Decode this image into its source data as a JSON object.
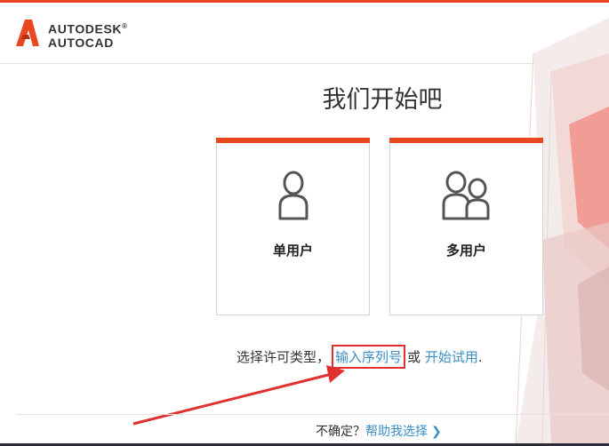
{
  "brand": {
    "line1": "AUTODESK",
    "trademark": "®",
    "line2": "AUTOCAD",
    "accent_color": "#e8471f"
  },
  "page": {
    "title": "我们开始吧"
  },
  "cards": {
    "single": {
      "label": "单用户",
      "icon": "single-user-icon"
    },
    "multi": {
      "label": "多用户",
      "icon": "multi-user-icon"
    }
  },
  "license": {
    "prompt": "选择许可类型，",
    "serial_link": "输入序列号",
    "or": "或",
    "trial_link": "开始试用",
    "end": "."
  },
  "footer": {
    "unsure": "不确定？",
    "help_link": "帮助我选择",
    "chevron": "❯"
  },
  "colors": {
    "accent": "#e8471f",
    "link": "#3b8ec8",
    "highlight_box": "#e03030"
  }
}
